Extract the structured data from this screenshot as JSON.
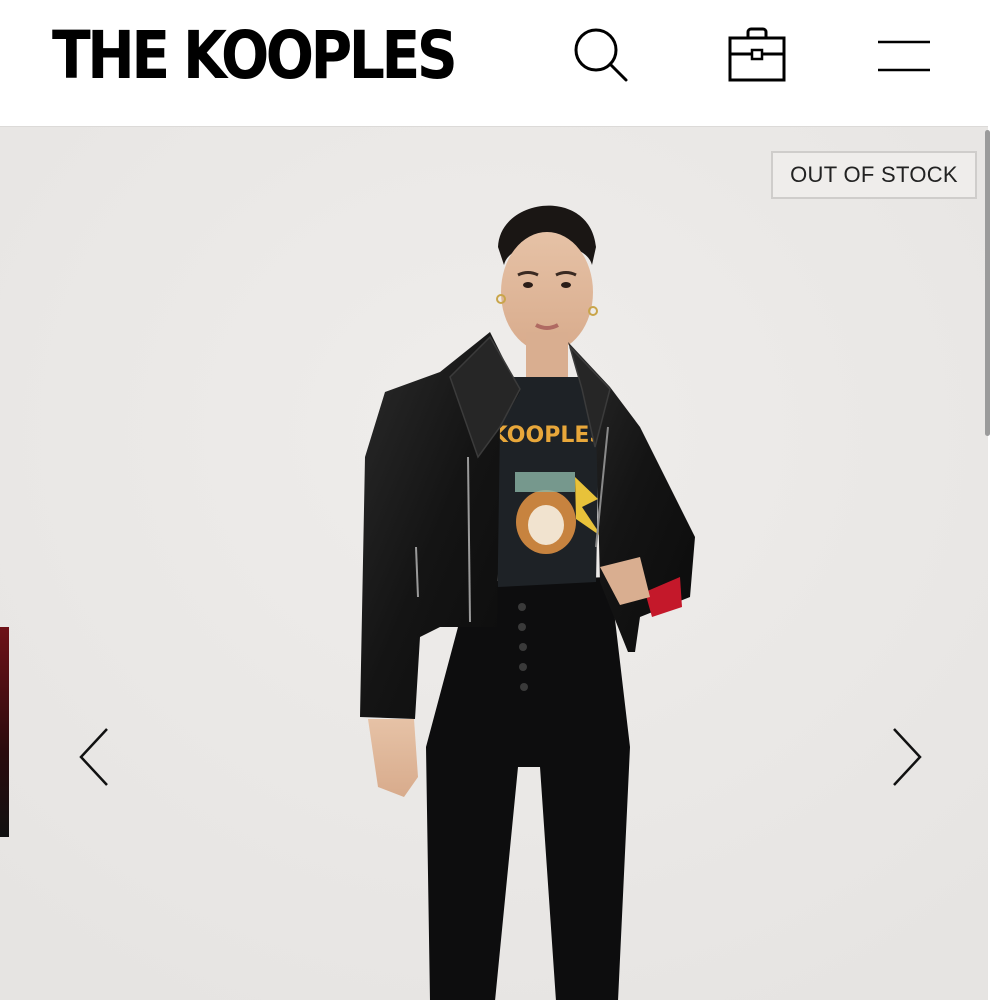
{
  "brand": {
    "logo_text": "THE KOOPLES"
  },
  "header": {
    "icons": [
      "search-icon",
      "shopping-bag-icon",
      "hamburger-menu-icon"
    ]
  },
  "product_gallery": {
    "badge": "OUT OF STOCK",
    "prev_icon": "chevron-left-icon",
    "next_icon": "chevron-right-icon",
    "image_description": "model-wearing-black-leather-biker-jacket"
  },
  "colors": {
    "header_bg": "#ffffff",
    "gallery_bg": "#ebe9e7",
    "badge_border": "#cfcdcb",
    "text": "#000000"
  }
}
